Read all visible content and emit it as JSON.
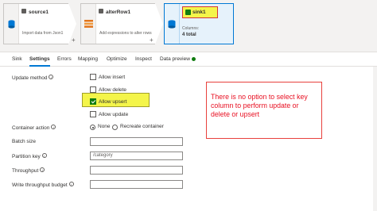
{
  "pipeline": {
    "source": {
      "title": "source1",
      "subtitle": "Import data from Json1"
    },
    "alter": {
      "title": "alterRow1",
      "subtitle": "Add expressions to alter rows"
    },
    "sink": {
      "title": "sink1",
      "columns_label": "Columns:",
      "columns_value": "4 total"
    }
  },
  "tabs": [
    "Sink",
    "Settings",
    "Errors",
    "Mapping",
    "Optimize",
    "Inspect",
    "Data preview"
  ],
  "form": {
    "update_method_label": "Update method",
    "options": [
      "Allow insert",
      "Allow delete",
      "Allow upsert",
      "Allow update"
    ],
    "checked_option": "Allow upsert",
    "container_action_label": "Container action",
    "radio_none": "None",
    "radio_recreate": "Recreate container",
    "batch_size_label": "Batch size",
    "partition_key_label": "Partition key",
    "partition_key_value": "/category",
    "throughput_label": "Throughput",
    "write_budget_label": "Write throughput budget"
  },
  "callout_text": "There is no option to select key column to perform update or delete or upsert",
  "colors": {
    "accent": "#0078d4",
    "success": "#107c10",
    "highlight": "#f4f54a",
    "callout": "#e81123"
  }
}
